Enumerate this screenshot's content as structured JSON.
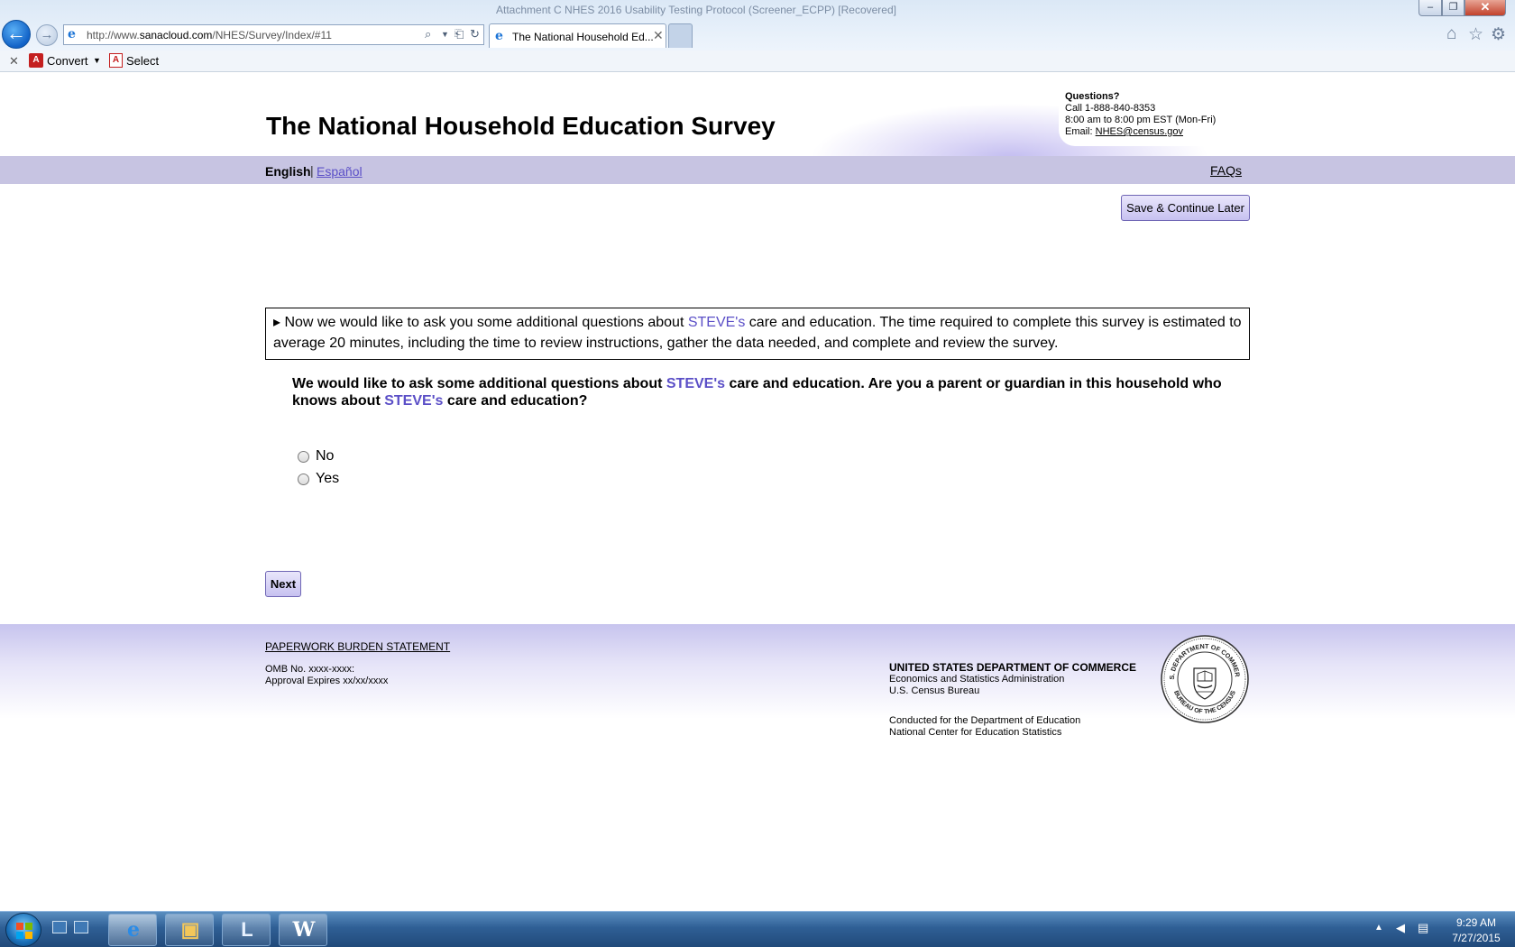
{
  "browser": {
    "window_title": "Attachment C NHES 2016 Usability Testing Protocol (Screener_ECPP) [Recovered]",
    "url_prefix": "http://www.",
    "url_domain": "sanacloud.com",
    "url_path": "/NHES/Survey/Index/#11",
    "tab_title": "The National Household Ed...",
    "toolbar": {
      "convert_label": "Convert",
      "select_label": "Select"
    }
  },
  "header": {
    "title": "The National Household Education Survey",
    "contact": {
      "heading": "Questions?",
      "phone": "Call 1-888-840-8353",
      "hours": "8:00 am to 8:00 pm EST (Mon-Fri)",
      "email_label": "Email: ",
      "email": "NHES@census.gov"
    }
  },
  "langbar": {
    "english": "English",
    "separator": "|",
    "spanish": "Español",
    "faqs": "FAQs"
  },
  "save_button": "Save & Continue Later",
  "intro": {
    "marker": "▸",
    "part1": " Now we would like to ask you some additional questions about ",
    "name": "STEVE's",
    "part2": " care and education. The time required to complete this survey is estimated to average 20 minutes, including the time to review instructions, gather the data needed, and complete and review the survey."
  },
  "question": {
    "part1": "We would like to ask some additional questions about ",
    "name1": "STEVE's",
    "part2": " care and education. Are you a parent or guardian in this household who knows about ",
    "name2": "STEVE's",
    "part3": " care and education?"
  },
  "options": {
    "no": "No",
    "yes": "Yes"
  },
  "next_button": "Next",
  "footer": {
    "paperwork": "PAPERWORK BURDEN STATEMENT",
    "omb": "OMB No. xxxx-xxxx:",
    "approval": "Approval Expires xx/xx/xxxx",
    "dept_title": "UNITED STATES DEPARTMENT OF COMMERCE",
    "dept_line2": "Economics and Statistics Administration",
    "dept_line3": "U.S. Census Bureau",
    "conducted1": "Conducted for the Department of Education",
    "conducted2": "National Center for Education Statistics",
    "seal_text_top": "U.S. DEPARTMENT OF COMMERCE",
    "seal_text_bottom": "BUREAU OF THE CENSUS"
  },
  "taskbar": {
    "time": "9:29 AM",
    "date": "7/27/2015"
  },
  "colors": {
    "accent_purple": "#5b4fc7",
    "langbar": "#c7c4e2",
    "button_fill": "#c7c1f0"
  }
}
